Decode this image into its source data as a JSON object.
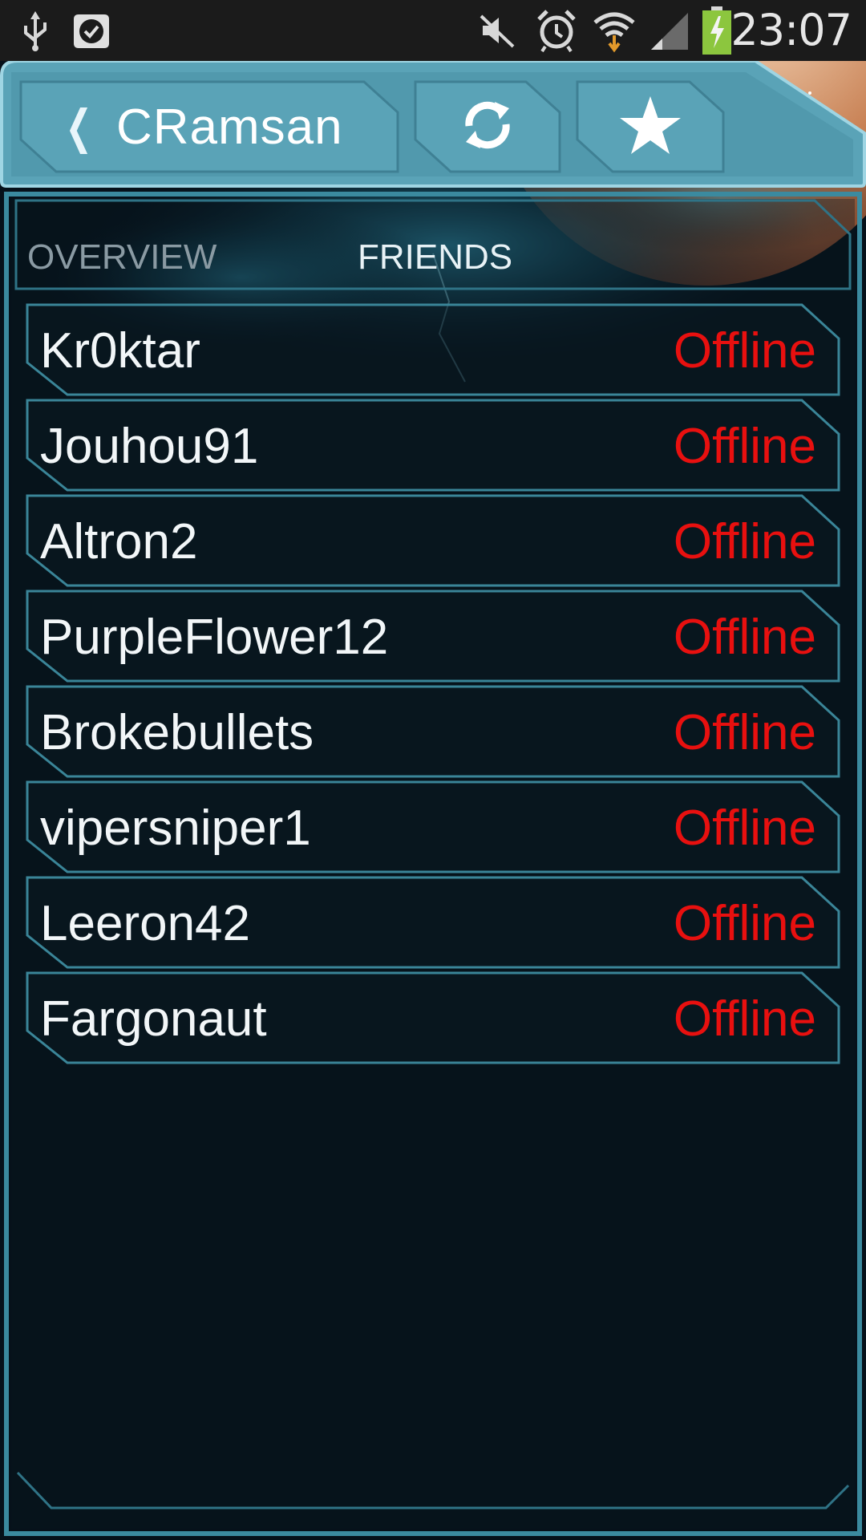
{
  "status_bar": {
    "time": "23:07",
    "icons": [
      "usb-icon",
      "checkmark-notification-icon",
      "mute-icon",
      "alarm-icon",
      "wifi-icon",
      "signal-icon",
      "battery-charging-icon"
    ]
  },
  "header": {
    "back_icon": "chevron-left-icon",
    "title": "CRamsan",
    "refresh_icon": "refresh-icon",
    "favorite_icon": "star-icon"
  },
  "tabs": [
    {
      "label": "OVERVIEW",
      "active": false
    },
    {
      "label": "FRIENDS",
      "active": true
    }
  ],
  "friends": [
    {
      "name": "Kr0ktar",
      "status": "Offline"
    },
    {
      "name": "Jouhou91",
      "status": "Offline"
    },
    {
      "name": "Altron2",
      "status": "Offline"
    },
    {
      "name": "PurpleFlower12",
      "status": "Offline"
    },
    {
      "name": "Brokebullets",
      "status": "Offline"
    },
    {
      "name": "vipersniper1",
      "status": "Offline"
    },
    {
      "name": "Leeron42",
      "status": "Offline"
    },
    {
      "name": "Fargonaut",
      "status": "Offline"
    }
  ],
  "colors": {
    "accent": "#3f8ea3",
    "header": "#5fa9bd",
    "offline": "#e8100f",
    "panel": "#0a1820"
  }
}
